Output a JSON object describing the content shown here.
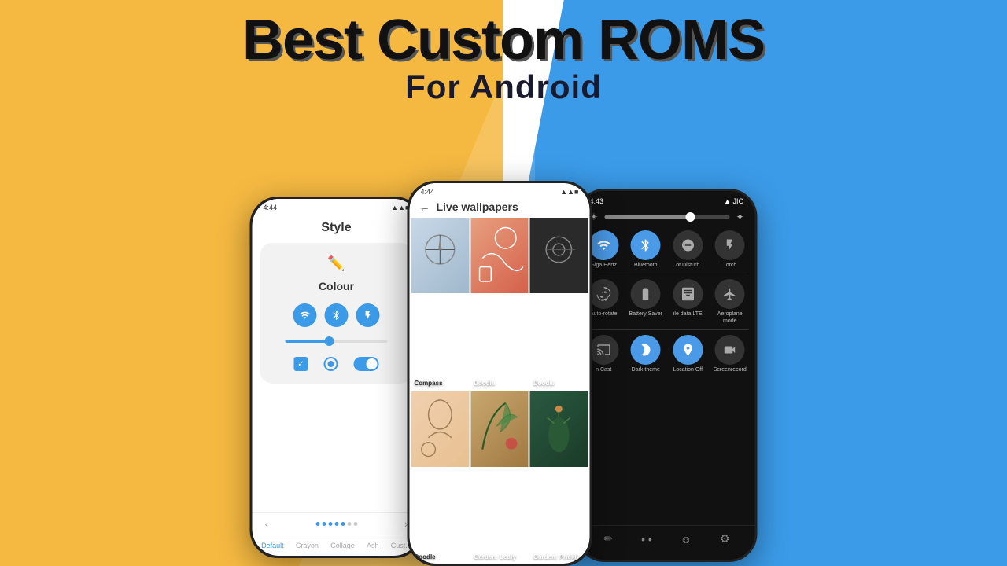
{
  "background": {
    "yellow": "#F5B942",
    "blue": "#3B9BE8"
  },
  "title": {
    "main": "Best Custom ROMS",
    "sub": "For Android"
  },
  "phone1": {
    "time": "4:44",
    "screen_title": "Style",
    "colour_label": "Colour",
    "nav_tabs": [
      "Default",
      "Crayon",
      "Collage",
      "Ash",
      "Cust..."
    ]
  },
  "phone2": {
    "time": "4:44",
    "header": "Live wallpapers",
    "wallpapers": [
      {
        "name": "Compass",
        "bg": "light-blue"
      },
      {
        "name": "Doodle",
        "bg": "orange"
      },
      {
        "name": "Doodle",
        "bg": "dark"
      },
      {
        "name": "Doodle",
        "bg": "tan"
      },
      {
        "name": "Garden: Leafy",
        "bg": "beige"
      },
      {
        "name": "Garden: Prickly",
        "bg": "dark-green"
      }
    ]
  },
  "phone3": {
    "time": "4:43",
    "carrier": "JIO",
    "tiles": [
      {
        "label": "Giga Hertz",
        "icon": "wifi",
        "active": true
      },
      {
        "label": "Bluetooth",
        "icon": "bluetooth",
        "active": true
      },
      {
        "label": "ot Disturb",
        "icon": "minus-circle",
        "active": false
      },
      {
        "label": "Torch",
        "icon": "flashlight",
        "active": false
      },
      {
        "label": "Auto-rotate",
        "icon": "rotate",
        "active": false
      },
      {
        "label": "Battery Saver",
        "icon": "battery",
        "active": false
      },
      {
        "label": "ile data LTE",
        "icon": "data",
        "active": false
      },
      {
        "label": "Aeroplane mode",
        "icon": "plane",
        "active": false
      },
      {
        "label": "n Cast",
        "icon": "cast",
        "active": false
      },
      {
        "label": "Dark theme",
        "icon": "moon",
        "active": true
      },
      {
        "label": "Location Off",
        "icon": "location",
        "active": true
      },
      {
        "label": "Screenrecord",
        "icon": "record",
        "active": false
      }
    ]
  }
}
